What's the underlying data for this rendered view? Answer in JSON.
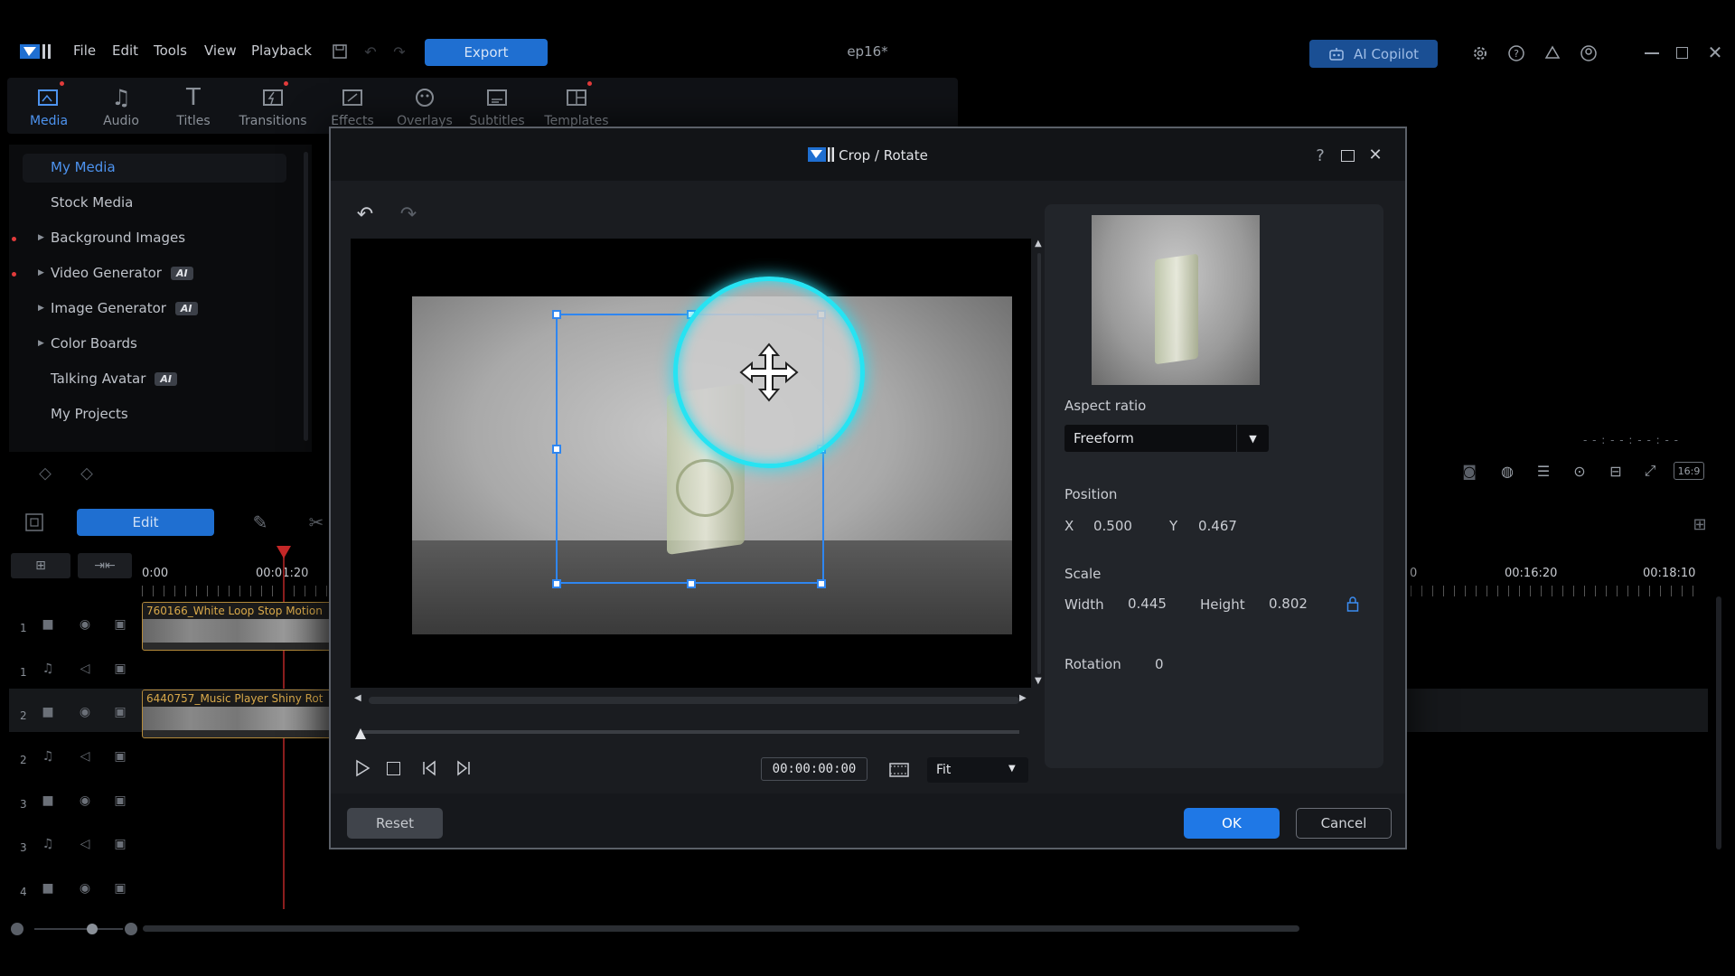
{
  "app": {
    "menu": [
      "File",
      "Edit",
      "Tools",
      "View",
      "Playback"
    ],
    "export_label": "Export",
    "doc_title": "ep16*",
    "ai_copilot_label": "AI Copilot"
  },
  "rooms": [
    {
      "label": "Media",
      "icon": "media-icon",
      "active": true
    },
    {
      "label": "Audio",
      "icon": "music-note-icon"
    },
    {
      "label": "Titles",
      "icon": "text-t-icon"
    },
    {
      "label": "Transitions",
      "icon": "transitions-icon"
    },
    {
      "label": "Effects",
      "icon": "effects-icon"
    },
    {
      "label": "Overlays",
      "icon": "overlays-icon"
    },
    {
      "label": "Subtitles",
      "icon": "subtitles-icon"
    },
    {
      "label": "Templates",
      "icon": "templates-icon"
    }
  ],
  "media_panel": {
    "items": [
      {
        "label": "My Media"
      },
      {
        "label": "Stock Media"
      },
      {
        "label": "Background Images"
      },
      {
        "label": "Video Generator",
        "badge": "AI"
      },
      {
        "label": "Image Generator",
        "badge": "AI"
      },
      {
        "label": "Color Boards"
      },
      {
        "label": "Talking Avatar",
        "badge": "AI"
      },
      {
        "label": "My Projects"
      }
    ]
  },
  "timeline": {
    "edit_label": "Edit",
    "ruler": [
      "0:00",
      "00:01:20",
      "0",
      "00:16:20",
      "00:18:10"
    ],
    "track_numbers": [
      "1",
      "1",
      "2",
      "2",
      "3",
      "3",
      "4"
    ],
    "clips": [
      {
        "label": "760166_White Loop Stop Motion"
      },
      {
        "label": "6440757_Music Player Shiny Rot"
      }
    ],
    "preview_ratio": "16:9",
    "timecode_dashes": "- - : - - : - - : - -"
  },
  "dialog": {
    "title": "Crop / Rotate",
    "aspect_ratio_label": "Aspect ratio",
    "aspect_ratio_value": "Freeform",
    "position_label": "Position",
    "x_label": "X",
    "x_value": "0.500",
    "y_label": "Y",
    "y_value": "0.467",
    "scale_label": "Scale",
    "width_label": "Width",
    "width_value": "0.445",
    "height_label": "Height",
    "height_value": "0.802",
    "rotation_label": "Rotation",
    "rotation_value": "0",
    "timecode": "00:00:00:00",
    "fit_value": "Fit",
    "reset_label": "Reset",
    "ok_label": "OK",
    "cancel_label": "Cancel"
  },
  "colors": {
    "accent": "#1f78e6",
    "highlight_ring": "#27e3f2",
    "clip_border": "#b48a3a"
  }
}
